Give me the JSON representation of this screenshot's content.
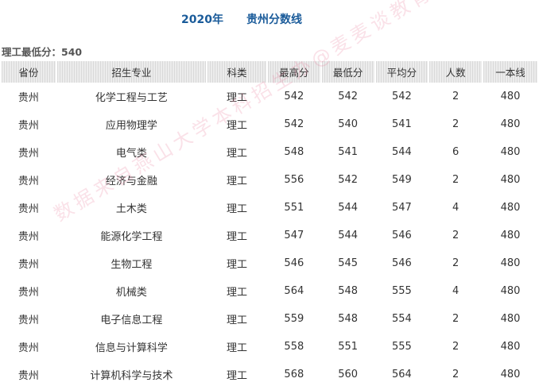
{
  "title": {
    "year": "2020年",
    "province": "贵州分数线"
  },
  "min_score_label": "理工最低分：540",
  "table": {
    "headers": [
      "省份",
      "招生专业",
      "科类",
      "最高分",
      "最低分",
      "平均分",
      "人数",
      "一本线"
    ],
    "rows": [
      [
        "贵州",
        "化学工程与工艺",
        "理工",
        "542",
        "542",
        "542",
        "2",
        "480"
      ],
      [
        "贵州",
        "应用物理学",
        "理工",
        "542",
        "540",
        "541",
        "2",
        "480"
      ],
      [
        "贵州",
        "电气类",
        "理工",
        "548",
        "541",
        "544",
        "6",
        "480"
      ],
      [
        "贵州",
        "经济与金融",
        "理工",
        "556",
        "542",
        "549",
        "2",
        "480"
      ],
      [
        "贵州",
        "土木类",
        "理工",
        "551",
        "544",
        "547",
        "4",
        "480"
      ],
      [
        "贵州",
        "能源化学工程",
        "理工",
        "547",
        "544",
        "546",
        "2",
        "480"
      ],
      [
        "贵州",
        "生物工程",
        "理工",
        "546",
        "545",
        "546",
        "2",
        "480"
      ],
      [
        "贵州",
        "机械类",
        "理工",
        "564",
        "548",
        "555",
        "4",
        "480"
      ],
      [
        "贵州",
        "电子信息工程",
        "理工",
        "559",
        "548",
        "554",
        "2",
        "480"
      ],
      [
        "贵州",
        "信息与计算科学",
        "理工",
        "558",
        "551",
        "555",
        "2",
        "480"
      ],
      [
        "贵州",
        "计算机科学与技术",
        "理工",
        "568",
        "560",
        "564",
        "2",
        "480"
      ]
    ]
  },
  "watermark": "数据来自燕山大学本科招生办@麦麦谈教育分享！",
  "colors": {
    "title": "#1a5b9a",
    "header_bg": "#e6e6e6",
    "watermark": "#e87896"
  }
}
